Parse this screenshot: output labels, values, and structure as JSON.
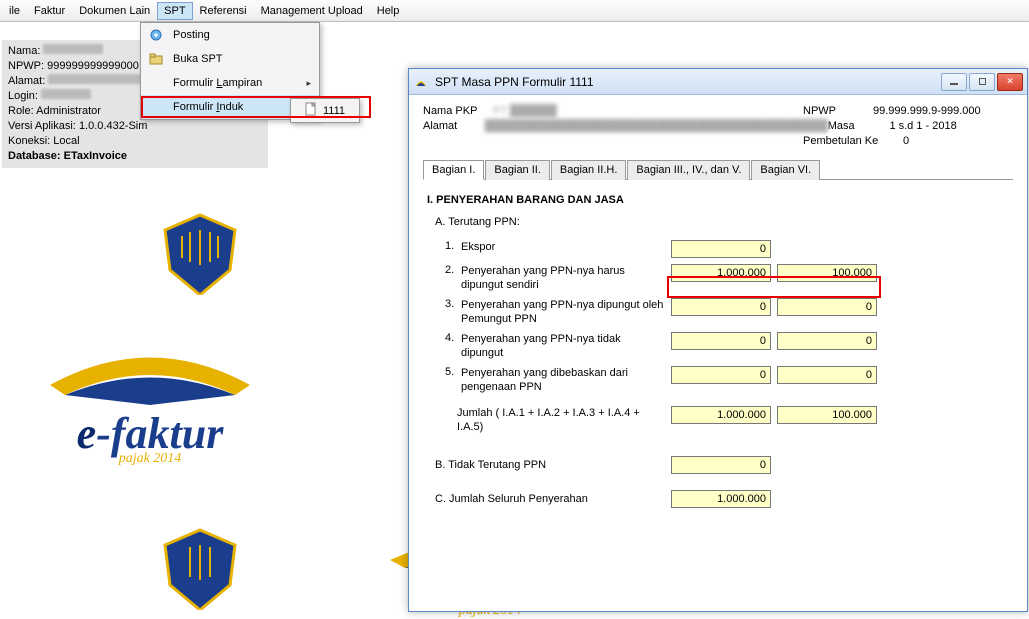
{
  "menubar": {
    "items": [
      "ile",
      "Faktur",
      "Dokumen Lain",
      "SPT",
      "Referensi",
      "Management Upload",
      "Help"
    ]
  },
  "dropdown": {
    "posting": "Posting",
    "buka": "Buka SPT",
    "lampiran_pre": "Formulir ",
    "lampiran_u": "L",
    "lampiran_post": "ampiran",
    "induk_pre": "Formulir ",
    "induk_u": "I",
    "induk_post": "nduk",
    "arrow": "▸"
  },
  "submenu": {
    "label": "1111"
  },
  "info": {
    "nama_l": "Nama:",
    "nama_v": "PT ██████",
    "npwp_l": "NPWP:",
    "npwp_v": "999999999999000",
    "alamat_l": "Alamat:",
    "alamat_v": "JL ███████████████",
    "login_l": "Login:",
    "login_v": "████ ████",
    "role_l": "Role:",
    "role_v": "Administrator",
    "versi_l": "Versi Aplikasi:",
    "versi_v": "1.0.0.432-Sim",
    "koneksi_l": "Koneksi:",
    "koneksi_v": "Local",
    "db_l": "Database:",
    "db_v": "ETaxInvoice"
  },
  "logo": {
    "efaktur_e": "e",
    "efaktur_rest": "-faktur",
    "pajak": "pajak 2014"
  },
  "form": {
    "title": "SPT Masa PPN Formulir 1111",
    "hdr": {
      "nama_l": "Nama PKP",
      "nama_v": "PT ██████",
      "alamat_l": "Alamat",
      "alamat_v": "████████████████████████████████████████████",
      "npwp_l": "NPWP",
      "npwp_v": "99.999.999.9-999.000",
      "masa_l": "Masa",
      "masa_v": "1 s.d 1 - 2018",
      "pembetulan_l": "Pembetulan Ke",
      "pembetulan_v": "0"
    },
    "tabs": [
      "Bagian I.",
      "Bagian II.",
      "Bagian II.H.",
      "Bagian III., IV., dan V.",
      "Bagian VI."
    ],
    "sec": {
      "title": "I. PENYERAHAN BARANG DAN JASA",
      "A": "A. Terutang PPN:",
      "r1": {
        "n": "1.",
        "d": "Ekspor",
        "a": "0"
      },
      "r2": {
        "n": "2.",
        "d": "Penyerahan yang PPN-nya harus dipungut sendiri",
        "a": "1.000.000",
        "b": "100.000"
      },
      "r3": {
        "n": "3.",
        "d": "Penyerahan yang PPN-nya dipungut oleh Pemungut PPN",
        "a": "0",
        "b": "0"
      },
      "r4": {
        "n": "4.",
        "d": "Penyerahan yang PPN-nya tidak dipungut",
        "a": "0",
        "b": "0"
      },
      "r5": {
        "n": "5.",
        "d": "Penyerahan yang dibebaskan dari pengenaan PPN",
        "a": "0",
        "b": "0"
      },
      "jml": {
        "d": "Jumlah ( I.A.1 + I.A.2 + I.A.3 + I.A.4 + I.A.5)",
        "a": "1.000.000",
        "b": "100.000"
      },
      "B": {
        "l": "B. Tidak Terutang PPN",
        "v": "0"
      },
      "C": {
        "l": "C. Jumlah Seluruh Penyerahan",
        "v": "1.000.000"
      }
    }
  }
}
